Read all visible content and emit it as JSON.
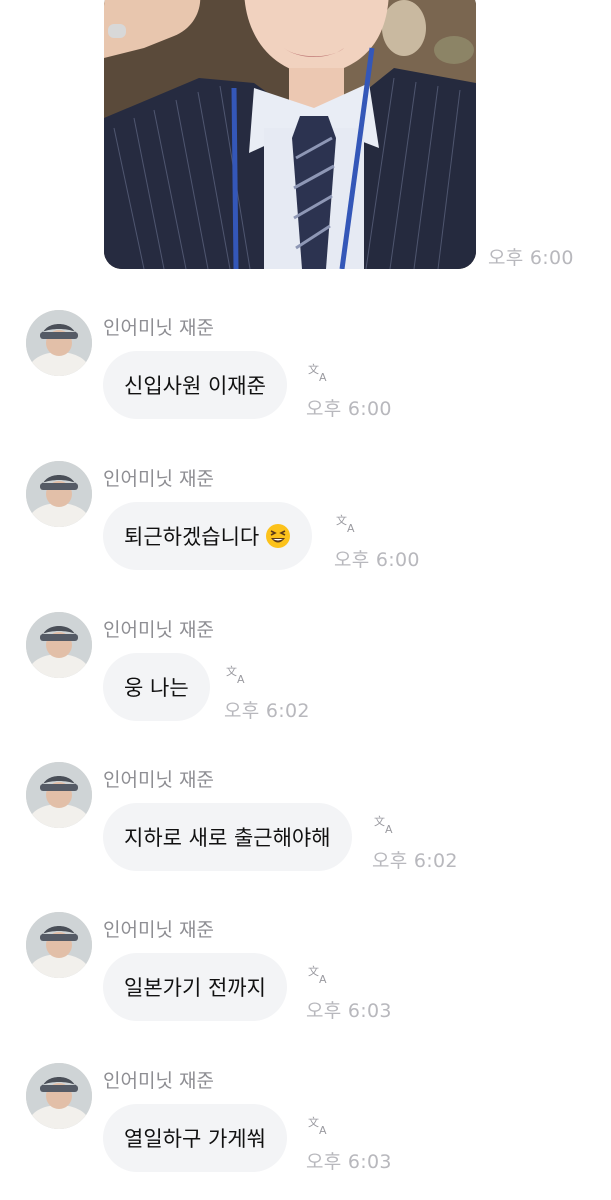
{
  "photo_message": {
    "time": "오후 6:00",
    "image": "selfie photo of person in pinstripe suit with lanyard and tie"
  },
  "translate_icon": "translate-icon",
  "messages": [
    {
      "sender": "인어미닛 재준",
      "text": "신입사원 이재준",
      "time": "오후 6:00"
    },
    {
      "sender": "인어미닛 재준",
      "text": "퇴근하겠습니다",
      "emoji": "grinning-squinting-face",
      "time": "오후 6:00"
    },
    {
      "sender": "인어미닛 재준",
      "text": "웅 나는",
      "time": "오후 6:02"
    },
    {
      "sender": "인어미닛 재준",
      "text": "지하로 새로 출근해야해",
      "time": "오후 6:02"
    },
    {
      "sender": "인어미닛 재준",
      "text": "일본가기 전까지",
      "time": "오후 6:03"
    },
    {
      "sender": "인어미닛 재준",
      "text": "열일하구 가게쒀",
      "time": "오후 6:03"
    }
  ]
}
